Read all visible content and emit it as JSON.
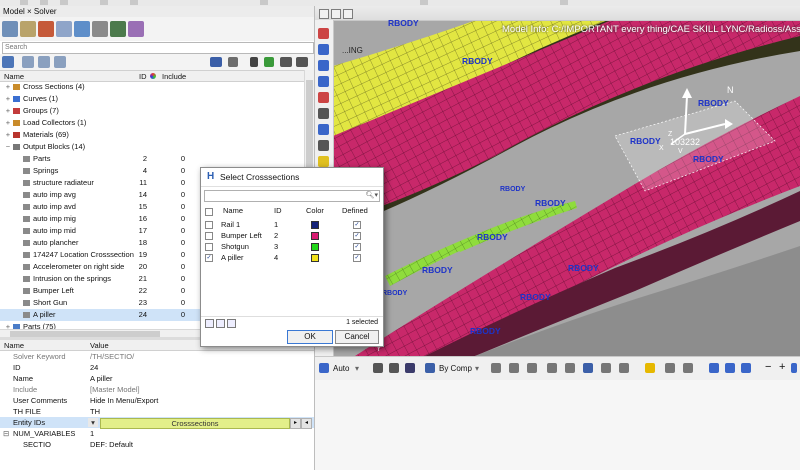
{
  "browser": {
    "tabs_label": "Model × Solver",
    "search_placeholder": "Search",
    "col_name": "Name",
    "col_id": "ID",
    "col_include": "Include",
    "tree": [
      {
        "label": "Cross Sections (4)",
        "level": 0,
        "expander": "+",
        "icon_color": "#c98b2a",
        "id": "",
        "include": ""
      },
      {
        "label": "Curves (1)",
        "level": 0,
        "expander": "+",
        "icon_color": "#3a6fd1",
        "id": "",
        "include": ""
      },
      {
        "label": "Groups (7)",
        "level": 0,
        "expander": "+",
        "icon_color": "#c33b3b",
        "id": "",
        "include": ""
      },
      {
        "label": "Load Collectors (1)",
        "level": 0,
        "expander": "+",
        "icon_color": "#c98b2a",
        "id": "",
        "include": ""
      },
      {
        "label": "Materials (69)",
        "level": 0,
        "expander": "+",
        "icon_color": "#b8342d",
        "id": "",
        "include": ""
      },
      {
        "label": "Output Blocks (14)",
        "level": 0,
        "expander": "−",
        "icon_color": "#777777",
        "id": "",
        "include": ""
      },
      {
        "label": "Parts",
        "level": 1,
        "expander": "",
        "icon_color": "#8a8a8a",
        "id": "2",
        "include": "0"
      },
      {
        "label": "Springs",
        "level": 1,
        "expander": "",
        "icon_color": "#8a8a8a",
        "id": "4",
        "include": "0"
      },
      {
        "label": "structure radiateur",
        "level": 1,
        "expander": "",
        "icon_color": "#8a8a8a",
        "id": "11",
        "include": "0"
      },
      {
        "label": "auto imp avg",
        "level": 1,
        "expander": "",
        "icon_color": "#8a8a8a",
        "id": "14",
        "include": "0"
      },
      {
        "label": "auto imp avd",
        "level": 1,
        "expander": "",
        "icon_color": "#8a8a8a",
        "id": "15",
        "include": "0"
      },
      {
        "label": "auto imp mig",
        "level": 1,
        "expander": "",
        "icon_color": "#8a8a8a",
        "id": "16",
        "include": "0"
      },
      {
        "label": "auto imp mid",
        "level": 1,
        "expander": "",
        "icon_color": "#8a8a8a",
        "id": "17",
        "include": "0"
      },
      {
        "label": "auto plancher",
        "level": 1,
        "expander": "",
        "icon_color": "#8a8a8a",
        "id": "18",
        "include": "0"
      },
      {
        "label": "174247 Location Crosssection",
        "level": 1,
        "expander": "",
        "icon_color": "#8a8a8a",
        "id": "19",
        "include": "0"
      },
      {
        "label": "Accelerometer on right side",
        "level": 1,
        "expander": "",
        "icon_color": "#8a8a8a",
        "id": "20",
        "include": "0"
      },
      {
        "label": "Intrusion on the springs",
        "level": 1,
        "expander": "",
        "icon_color": "#8a8a8a",
        "id": "21",
        "include": "0"
      },
      {
        "label": "Bumper Left",
        "level": 1,
        "expander": "",
        "icon_color": "#8a8a8a",
        "id": "22",
        "include": "0"
      },
      {
        "label": "Short Gun",
        "level": 1,
        "expander": "",
        "icon_color": "#8a8a8a",
        "id": "23",
        "include": "0"
      },
      {
        "label": "A piller",
        "level": 1,
        "expander": "",
        "icon_color": "#8a8a8a",
        "id": "24",
        "include": "0",
        "selected": true
      },
      {
        "label": "Parts (75)",
        "level": 0,
        "expander": "+",
        "icon_color": "#4a7cc7",
        "id": "",
        "include": ""
      }
    ]
  },
  "properties": {
    "col_name": "Name",
    "col_value": "Value",
    "rows": [
      {
        "name": "Solver Keyword",
        "value": "/TH/SECTIO/",
        "grey": true
      },
      {
        "name": "ID",
        "value": "24"
      },
      {
        "name": "Name",
        "value": "A piller"
      },
      {
        "name": "Include",
        "value": "[Master Model]",
        "grey": true
      },
      {
        "name": "User Comments",
        "value": "Hide In Menu/Export"
      },
      {
        "name": "TH FILE",
        "value": "TH"
      }
    ],
    "entity_ids_label": "Entity IDs",
    "entity_ids_value": "Crosssections",
    "num_variables_label": "NUM_VARIABLES",
    "num_variables_value": "1",
    "sectio_label": "SECTIO",
    "sectio_value": "DEF: Default"
  },
  "viewport": {
    "model_info": "Model Info: C:/IMPORTANT every thing/CAE SKILL LYNC/Radioss/Assin",
    "rbody_label": "RBODY",
    "node_id": "103232",
    "axis_n": "N",
    "axis_z": "Z",
    "axis_x": "X",
    "axis_v": "V",
    "axis_y": "Y",
    "partial_label": "...ING"
  },
  "bottom_toolbar": {
    "auto_label": "Auto",
    "by_comp_label": "By Comp"
  },
  "dialog": {
    "title": "Select Crosssections",
    "col_name": "Name",
    "col_id": "ID",
    "col_color": "Color",
    "col_defined": "Defined",
    "rows": [
      {
        "name": "Rail 1",
        "id": "1",
        "color": "#15237a",
        "checked": false,
        "defined": true
      },
      {
        "name": "Bumper Left",
        "id": "2",
        "color": "#d81b72",
        "checked": false,
        "defined": true
      },
      {
        "name": "Shotgun",
        "id": "3",
        "color": "#22d81a",
        "checked": false,
        "defined": true
      },
      {
        "name": "A piller",
        "id": "4",
        "color": "#f2e21a",
        "checked": true,
        "defined": true
      }
    ],
    "selection_count": "1 selected",
    "ok_label": "OK",
    "cancel_label": "Cancel"
  },
  "colors": {
    "model_magenta": "#c8286a",
    "model_yellow": "#e2e642",
    "model_green": "#8fdc3c",
    "rbody_blue": "#1e33c8",
    "viewport_bg": "#a7a7a7"
  }
}
